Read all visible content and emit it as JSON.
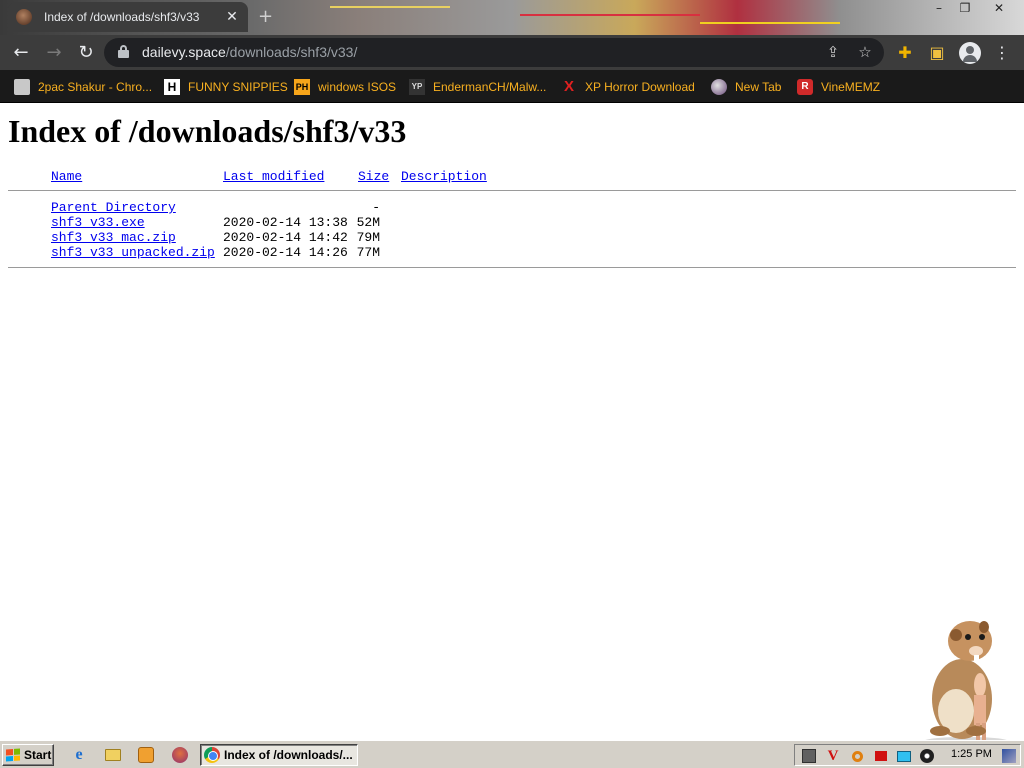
{
  "browser": {
    "tab": {
      "title": "Index of /downloads/shf3/v33",
      "close_glyph": "✕"
    },
    "new_tab_glyph": "+",
    "window_controls": {
      "minimize": "–",
      "maximize": "❐",
      "close": "✕"
    },
    "nav": {
      "back": "←",
      "forward": "→",
      "reload": "↻"
    },
    "omnibox": {
      "host": "dailevy.space",
      "path": "/downloads/shf3/v33/"
    },
    "omnibox_icons": {
      "share": "⇪",
      "bookmark_star": "☆"
    },
    "toolbar_icons": {
      "extensions": "✚",
      "side_panel": "▣",
      "menu": "⋮"
    },
    "bookmarks": [
      {
        "label": "2pac Shakur - Chro...",
        "icon": "bookmark-page-icon",
        "icon_text": ""
      },
      {
        "label": "FUNNY SNIPPIES",
        "icon": "letter-h-icon",
        "icon_text": "H"
      },
      {
        "label": "windows ISOS",
        "icon": "ph-icon",
        "icon_text": "PH"
      },
      {
        "label": "EndermanCH/Malw...",
        "icon": "yp-icon",
        "icon_text": "YP"
      },
      {
        "label": "XP Horror Download",
        "icon": "x-icon",
        "icon_text": "X"
      },
      {
        "label": "New Tab",
        "icon": "globe-icon",
        "icon_text": ""
      },
      {
        "label": "VineMEMZ",
        "icon": "r-icon",
        "icon_text": "R"
      }
    ]
  },
  "page": {
    "heading": "Index of /downloads/shf3/v33",
    "columns": {
      "name": "Name",
      "last_modified": "Last modified",
      "size": "Size",
      "description": "Description"
    },
    "parent": {
      "name": "Parent Directory",
      "size": "-"
    },
    "files": [
      {
        "name": "shf3_v33.exe",
        "modified": "2020-02-14 13:38",
        "size": "52M"
      },
      {
        "name": "shf3_v33_mac.zip",
        "modified": "2020-02-14 14:42",
        "size": "79M"
      },
      {
        "name": "shf3_v33_unpacked.zip",
        "modified": "2020-02-14 14:26",
        "size": "77M"
      }
    ]
  },
  "taskbar": {
    "start_label": "Start",
    "task_label": "Index of /downloads/...",
    "clock": "1:25 PM",
    "quick_launch": [
      "ie-icon",
      "folder-icon",
      "media-player-icon",
      "bonzi-icon"
    ],
    "tray_icons": [
      "network-icon",
      "v-icon",
      "search-icon",
      "flag-icon",
      "monitor-icon",
      "speaker-icon"
    ]
  },
  "colors": {
    "link": "#0000ee",
    "bookmark_text": "#f8b020",
    "chrome_dark": "#202124",
    "toolbar": "#3c3c3c",
    "taskbar": "#d4d0c8"
  }
}
